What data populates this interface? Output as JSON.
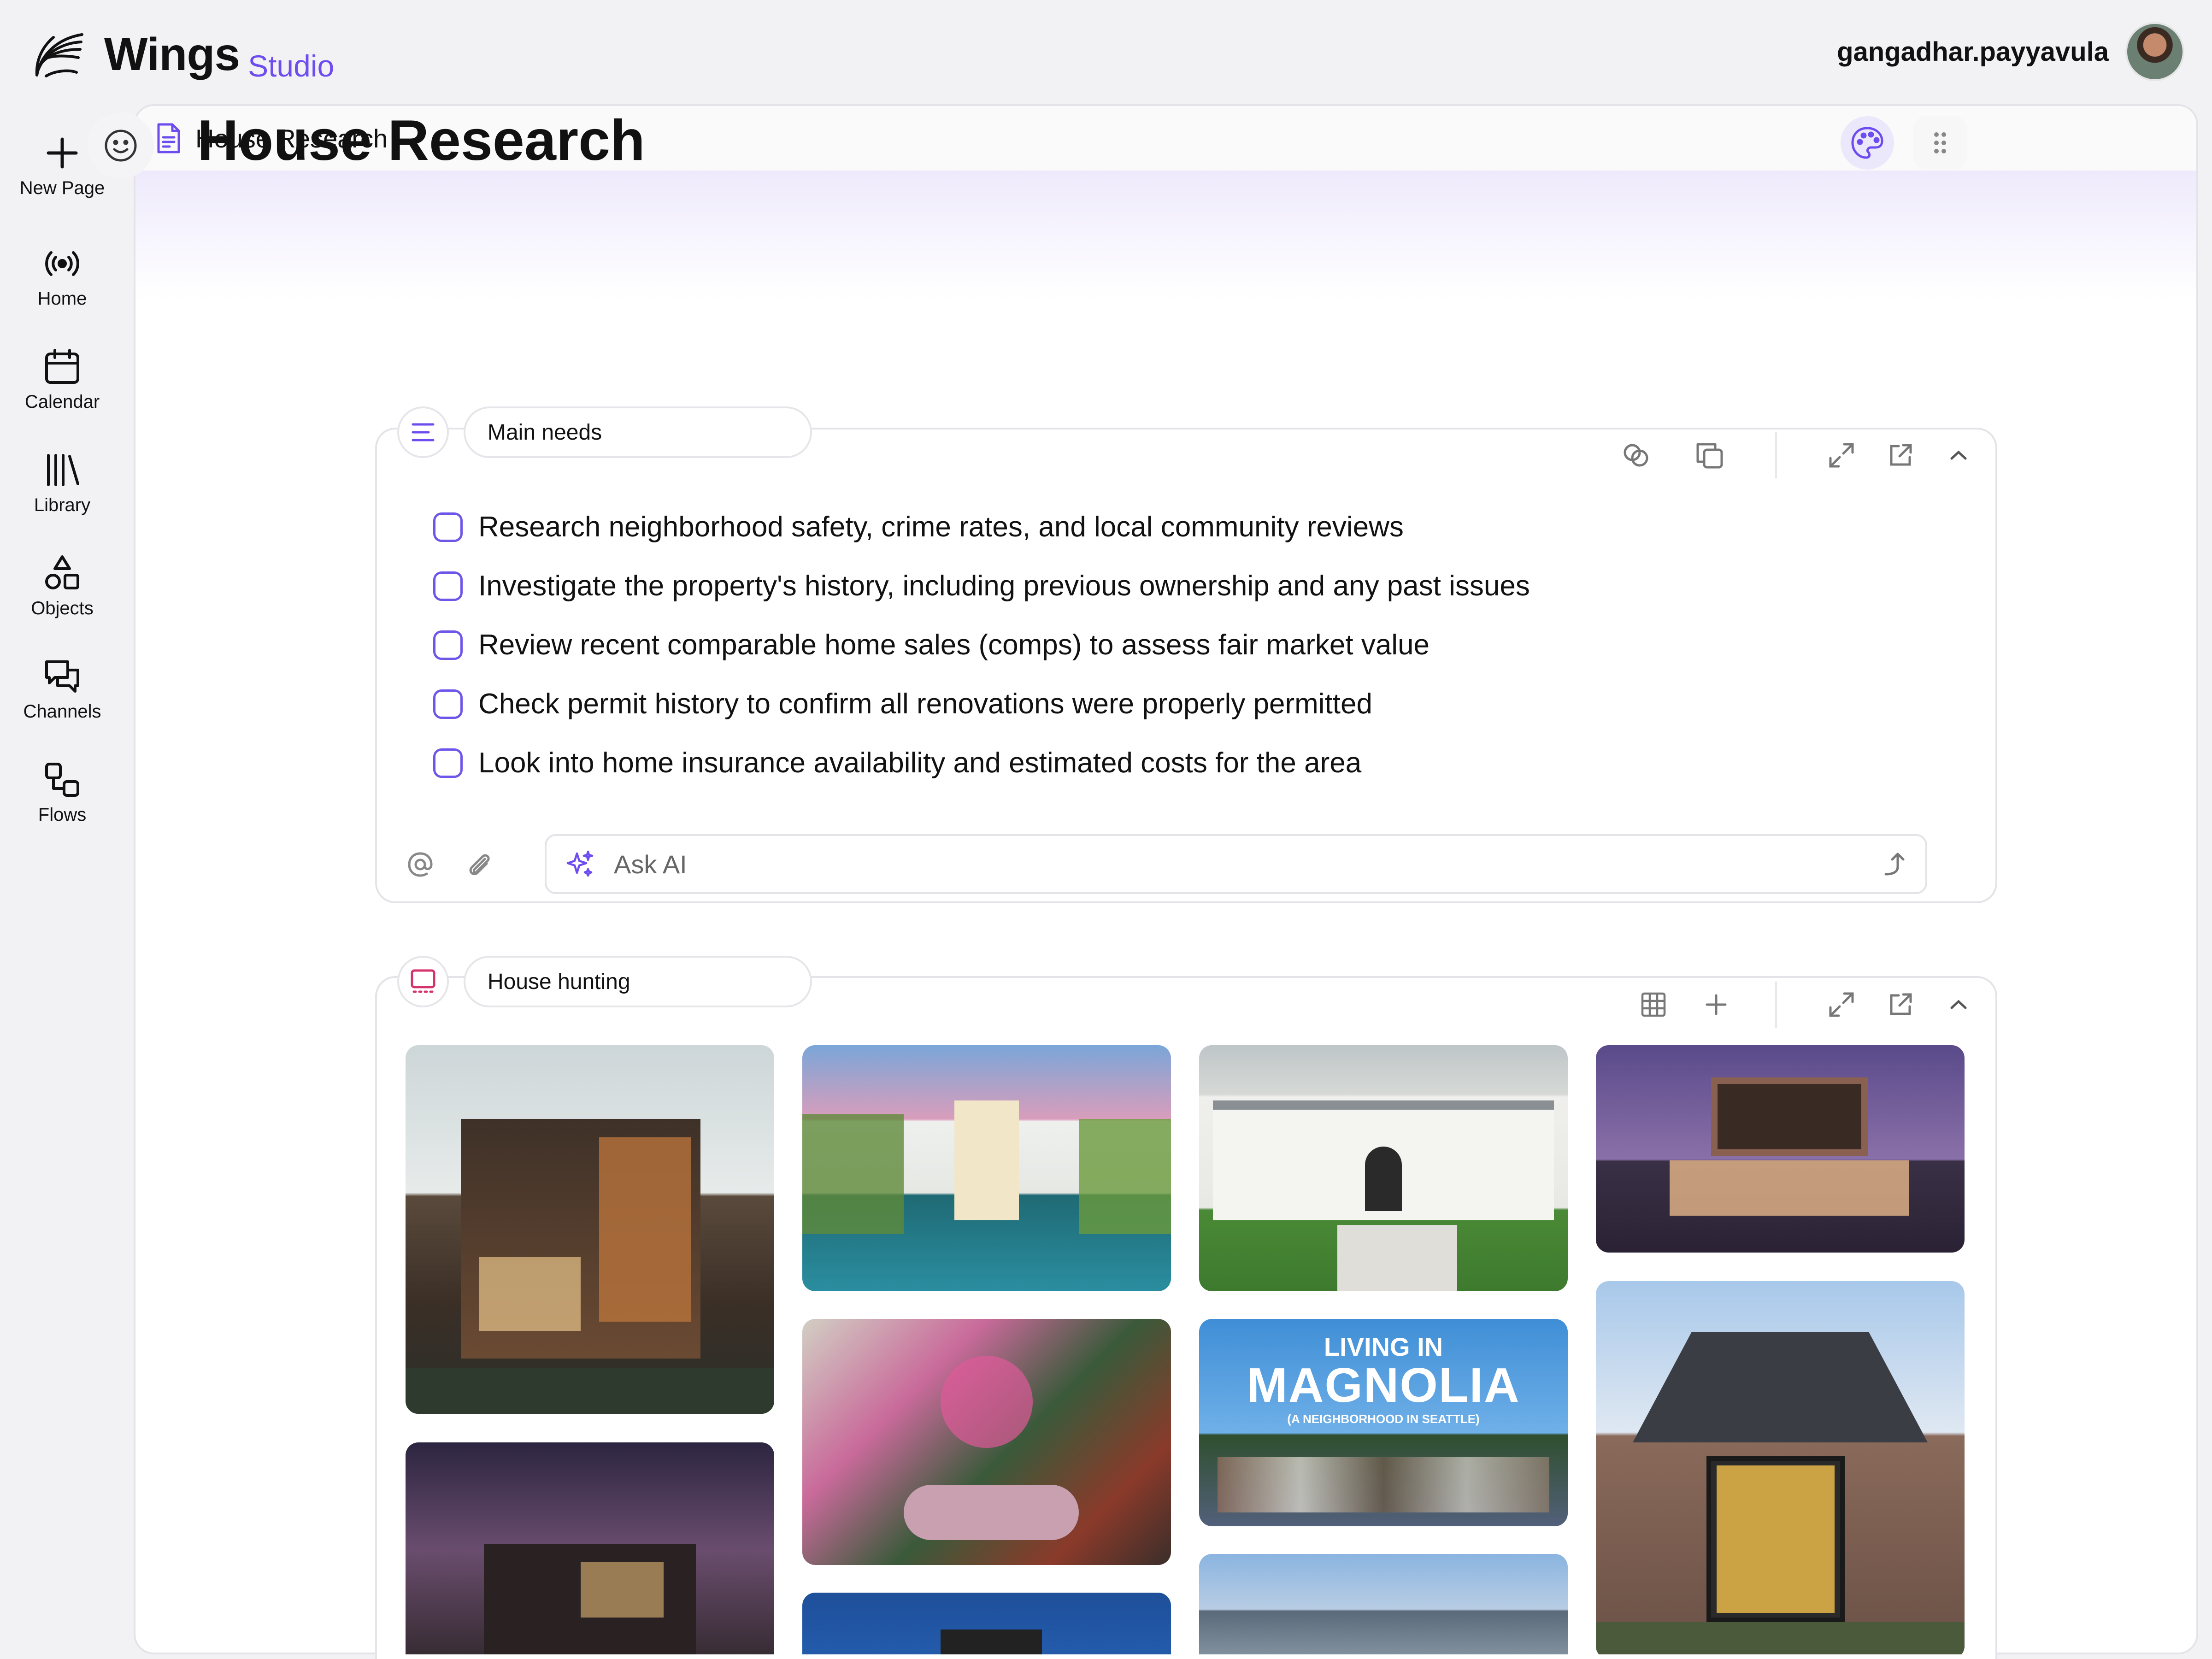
{
  "brand": {
    "name": "Wings",
    "sub": "Studio"
  },
  "user": {
    "username": "gangadhar.payyavula"
  },
  "nav": [
    {
      "label": "New Page",
      "icon": "plus-icon"
    },
    {
      "label": "Home",
      "icon": "broadcast-icon"
    },
    {
      "label": "Calendar",
      "icon": "calendar-icon"
    },
    {
      "label": "Library",
      "icon": "library-icon"
    },
    {
      "label": "Objects",
      "icon": "shapes-icon"
    },
    {
      "label": "Channels",
      "icon": "chat-bubbles-icon"
    },
    {
      "label": "Flows",
      "icon": "flow-icon"
    }
  ],
  "tab": {
    "title": "House Research"
  },
  "page": {
    "title": "House Research"
  },
  "main_needs": {
    "title": "Main needs",
    "items": [
      "Research neighborhood safety, crime rates, and local community reviews",
      "Investigate the property's history, including previous ownership and any past issues",
      "Review recent comparable home sales (comps) to assess fair market value",
      "Check permit history to confirm all renovations were properly permitted",
      "Look into home insurance availability and estimated costs for the area"
    ],
    "ask_placeholder": "Ask AI"
  },
  "house_hunting": {
    "title": "House hunting",
    "poster": {
      "line1": "LIVING IN",
      "line2": "MAGNOLIA",
      "line3": "(A NEIGHBORHOOD IN SEATTLE)"
    }
  },
  "colors": {
    "accent": "#6d4cf0",
    "checkbox": "#6d56e8",
    "gallery_icon": "#d6336c"
  }
}
